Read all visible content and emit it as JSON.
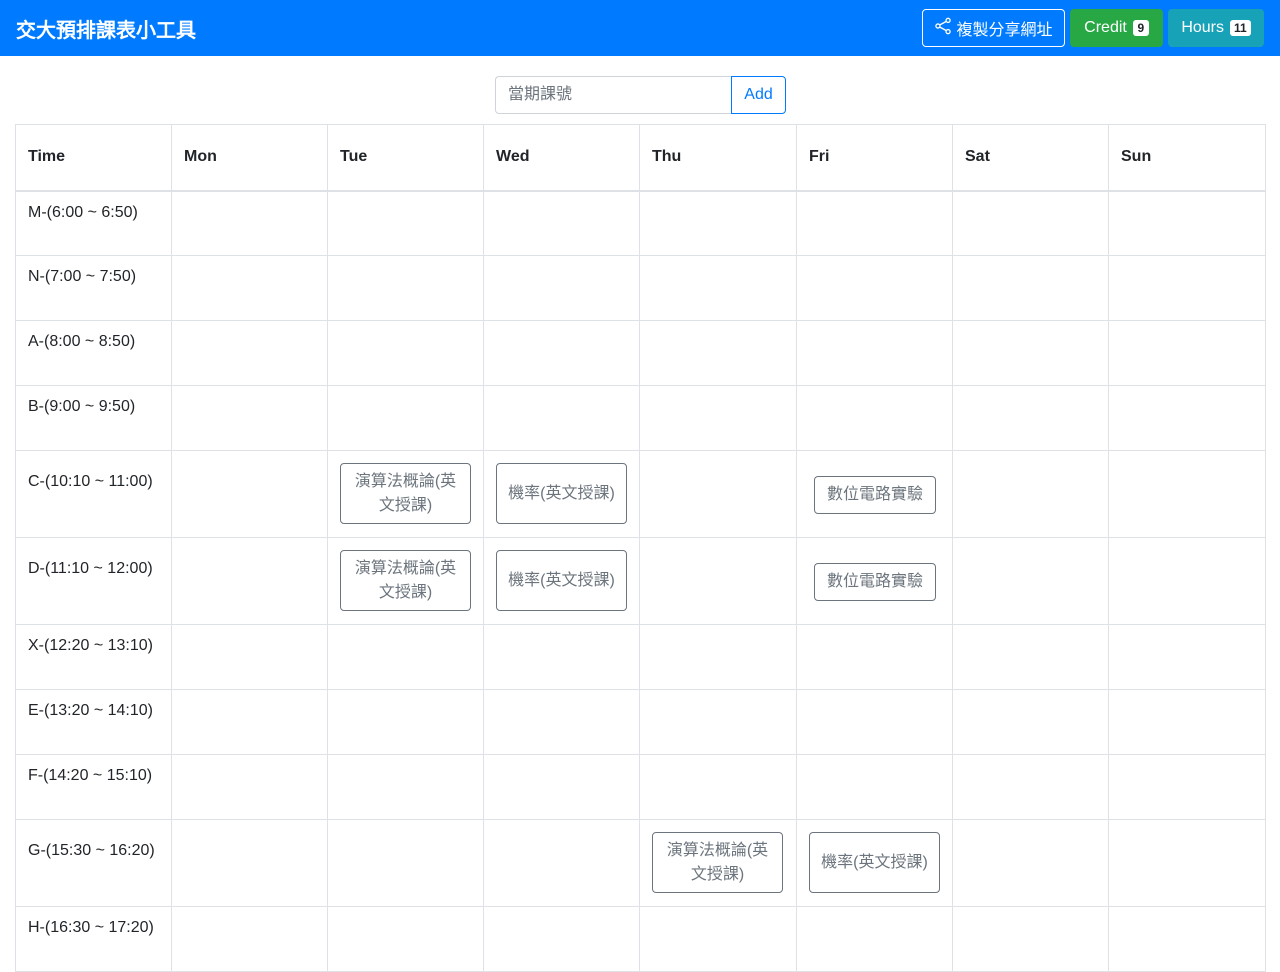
{
  "navbar": {
    "brand": "交大預排課表小工具",
    "share_label": "複製分享網址",
    "credit_label": "Credit",
    "credit_count": "9",
    "hours_label": "Hours",
    "hours_count": "11"
  },
  "search": {
    "placeholder": "當期課號",
    "value": "",
    "add_label": "Add"
  },
  "table": {
    "headers": [
      "Time",
      "Mon",
      "Tue",
      "Wed",
      "Thu",
      "Fri",
      "Sat",
      "Sun"
    ],
    "rows": [
      {
        "time": "M-(6:00 ~ 6:50)",
        "cells": [
          "",
          "",
          "",
          "",
          "",
          "",
          ""
        ]
      },
      {
        "time": "N-(7:00 ~ 7:50)",
        "cells": [
          "",
          "",
          "",
          "",
          "",
          "",
          ""
        ]
      },
      {
        "time": "A-(8:00 ~ 8:50)",
        "cells": [
          "",
          "",
          "",
          "",
          "",
          "",
          ""
        ]
      },
      {
        "time": "B-(9:00 ~ 9:50)",
        "cells": [
          "",
          "",
          "",
          "",
          "",
          "",
          ""
        ]
      },
      {
        "time": "C-(10:10 ~ 11:00)",
        "cells": [
          "",
          "演算法概論(英文授課)",
          "機率(英文授課)",
          "",
          "數位電路實驗",
          "",
          ""
        ]
      },
      {
        "time": "D-(11:10 ~ 12:00)",
        "cells": [
          "",
          "演算法概論(英文授課)",
          "機率(英文授課)",
          "",
          "數位電路實驗",
          "",
          ""
        ]
      },
      {
        "time": "X-(12:20 ~ 13:10)",
        "cells": [
          "",
          "",
          "",
          "",
          "",
          "",
          ""
        ]
      },
      {
        "time": "E-(13:20 ~ 14:10)",
        "cells": [
          "",
          "",
          "",
          "",
          "",
          "",
          ""
        ]
      },
      {
        "time": "F-(14:20 ~ 15:10)",
        "cells": [
          "",
          "",
          "",
          "",
          "",
          "",
          ""
        ]
      },
      {
        "time": "G-(15:30 ~ 16:20)",
        "cells": [
          "",
          "",
          "",
          "演算法概論(英文授課)",
          "機率(英文授課)",
          "",
          ""
        ]
      },
      {
        "time": "H-(16:30 ~ 17:20)",
        "cells": [
          "",
          "",
          "",
          "",
          "",
          "",
          ""
        ]
      }
    ]
  },
  "colors": {
    "navbar": "#007bff",
    "credit": "#28a745",
    "hours": "#17a2b8",
    "course_outline": "#6c757d"
  }
}
